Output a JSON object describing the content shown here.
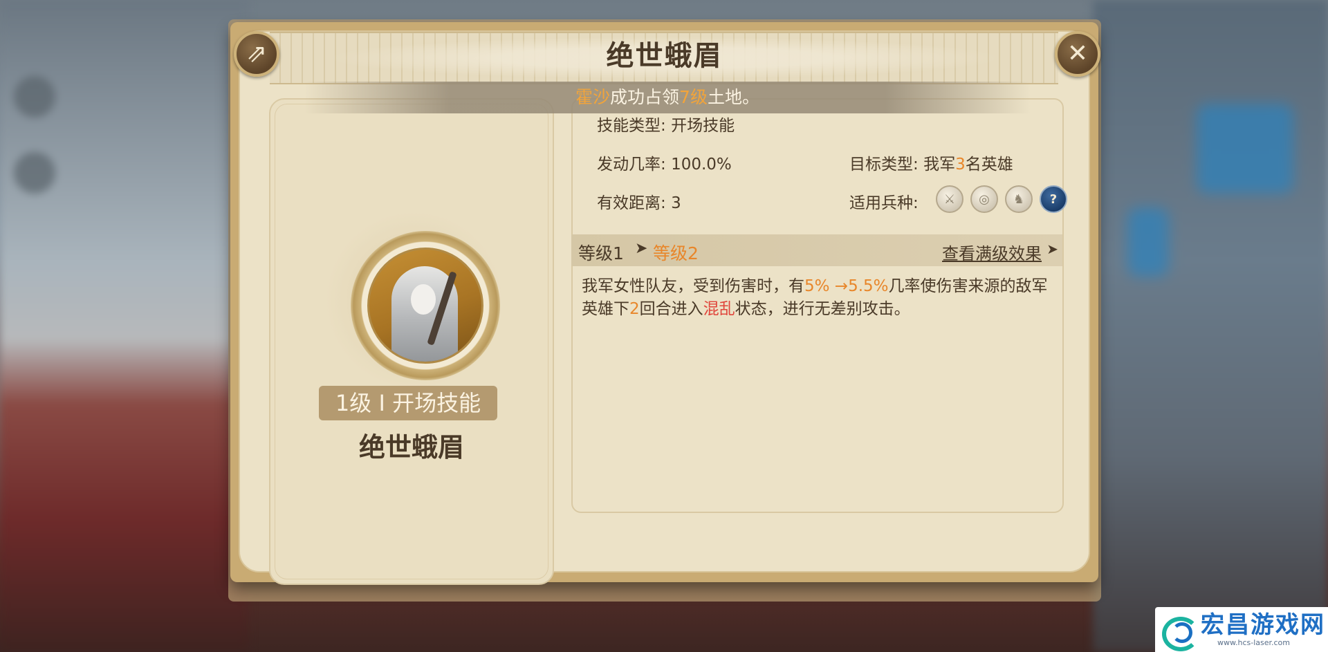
{
  "panel": {
    "title": "绝世蛾眉",
    "close_glyph": "✕",
    "share_glyph": "⇗"
  },
  "notice": {
    "player": "霍沙",
    "text_mid": "成功占领",
    "count": "7级",
    "text_end": "土地。"
  },
  "skill": {
    "tag": "1级 I 开场技能",
    "name": "绝世蛾眉"
  },
  "info": {
    "type_label": "技能类型:",
    "type_value": "开场技能",
    "rate_label": "发动几率:",
    "rate_value": "100.0%",
    "range_label": "有效距离:",
    "range_value": "3",
    "target_label": "目标类型:",
    "target_prefix": "我军",
    "target_count": "3",
    "target_suffix": "名英雄",
    "troops_label": "适用兵种:",
    "troop_icons": [
      "sword-icon",
      "bow-target-icon",
      "horse-icon",
      "question-icon"
    ]
  },
  "level": {
    "current": "等级1",
    "arrow": "➤",
    "next": "等级2",
    "full_effect": "查看满级效果",
    "full_arrow": "➤"
  },
  "description": {
    "p1": "我军女性队友，受到伤害时，有",
    "chance": "5% →5.5%",
    "p2": "几率使伤害来源的敌军英雄下",
    "rounds": "2",
    "p3": "回合进入",
    "status": "混乱",
    "p4": "状态，进行无差别攻击。"
  },
  "watermark": {
    "title": "宏昌游戏网",
    "url": "www.hcs-laser.com"
  },
  "colors": {
    "accent_orange": "#e8862a",
    "status_red": "#e0443a",
    "panel_gold": "#c9ab73",
    "parchment": "#ece2c7"
  }
}
